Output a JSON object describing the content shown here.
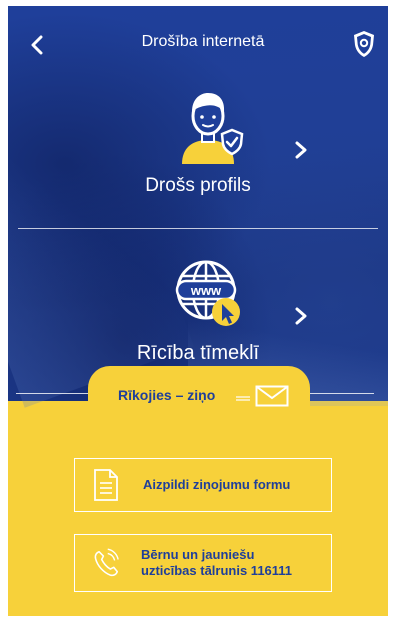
{
  "header": {
    "title": "Drošība internetā",
    "back_icon": "chevron-left-icon",
    "emblem_icon": "state-police-emblem-icon"
  },
  "menu": [
    {
      "label": "Drošs profils",
      "icon": "user-shield-icon"
    },
    {
      "label": "Rīcība tīmeklī",
      "icon": "www-globe-cursor-icon",
      "globe_text": "www"
    }
  ],
  "report": {
    "title": "Rīkojies – ziņo",
    "icon": "envelope-icon"
  },
  "actions": [
    {
      "label": "Aizpildi ziņojumu formu",
      "icon": "form-document-icon"
    },
    {
      "label_line1": "Bērnu un jauniešu",
      "label_line2": "uzticības tālrunis 116111",
      "icon": "phone-icon"
    }
  ],
  "colors": {
    "brand_blue": "#1f3f9a",
    "accent_yellow": "#f7d13a",
    "white": "#ffffff"
  }
}
